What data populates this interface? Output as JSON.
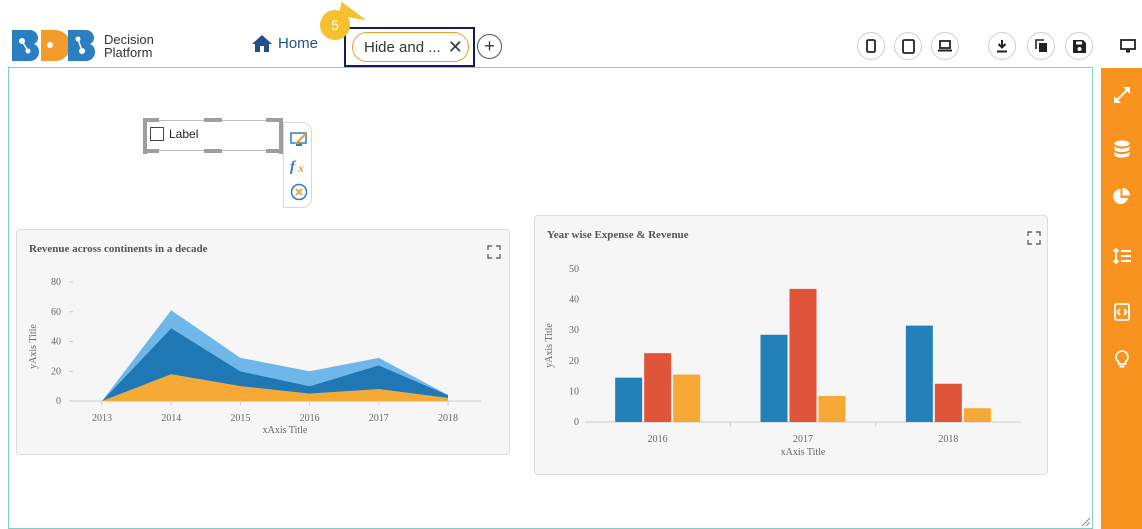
{
  "header": {
    "logo_line1": "Decision",
    "logo_line2": "Platform",
    "home_label": "Home",
    "active_tab_label": "Hide and ...",
    "step_number": "5"
  },
  "label_widget": {
    "text": "Label"
  },
  "charts": [
    {
      "chart_data": {
        "type": "area",
        "title": "Revenue across continents in a decade",
        "xlabel": "xAxis Title",
        "ylabel": "yAxis Title",
        "categories": [
          "2013",
          "2014",
          "2015",
          "2016",
          "2017",
          "2018"
        ],
        "ylim": [
          0,
          80
        ],
        "yticks": [
          0,
          20,
          40,
          60,
          80
        ],
        "stacked": true,
        "series": [
          {
            "values": [
              0,
              18,
              10,
              5,
              8,
              2
            ],
            "color": "#f7a935"
          },
          {
            "values": [
              0,
              31,
              10,
              5,
              16,
              2
            ],
            "color": "#1f77b4"
          },
          {
            "values": [
              0,
              12,
              9,
              10,
              5,
              0
            ],
            "color": "#6fb7e9"
          }
        ]
      }
    },
    {
      "chart_data": {
        "type": "bar",
        "title": "Year wise Expense & Revenue",
        "xlabel": "xAxis Title",
        "ylabel": "yAxis Title",
        "categories": [
          "2016",
          "2017",
          "2018"
        ],
        "ylim": [
          0,
          50
        ],
        "yticks": [
          0,
          10,
          20,
          30,
          40,
          50
        ],
        "series": [
          {
            "values": [
              14.5,
              28.5,
              31.5
            ],
            "color": "#2381b8"
          },
          {
            "values": [
              22.5,
              43.5,
              12.5
            ],
            "color": "#e0553a"
          },
          {
            "values": [
              15.5,
              8.5,
              4.5
            ],
            "color": "#f7a935"
          }
        ]
      }
    }
  ]
}
